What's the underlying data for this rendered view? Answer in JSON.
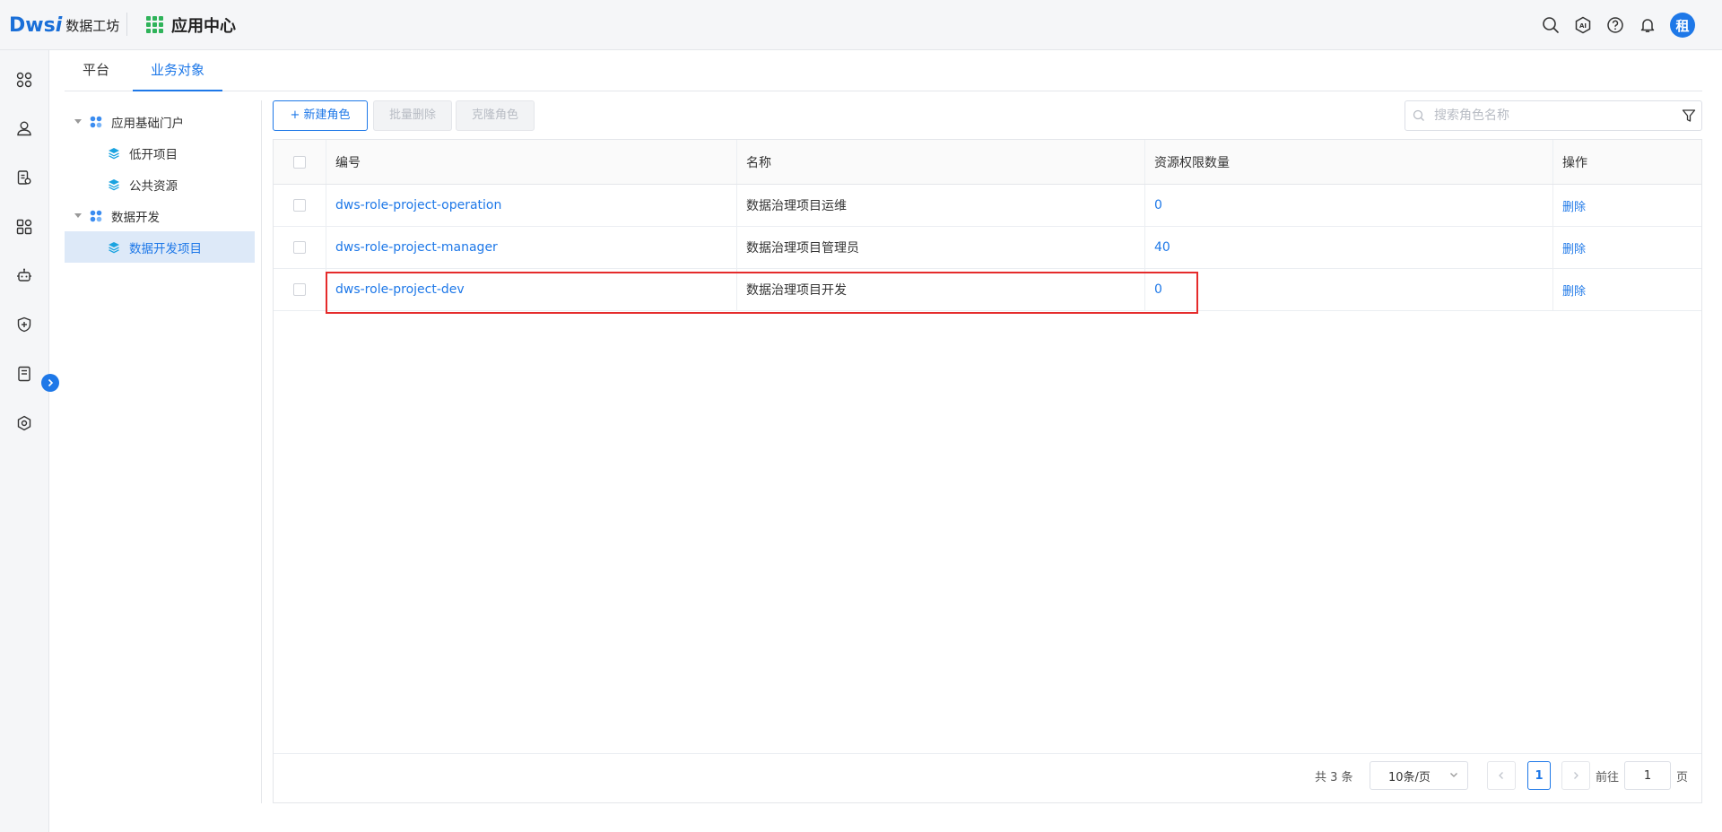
{
  "header": {
    "logo_mark": "Dws",
    "logo_mark_i": "i",
    "logo_text": "数据工坊",
    "app_center_label": "应用中心",
    "avatar_text": "租"
  },
  "tabs": [
    {
      "label": "平台",
      "active": false
    },
    {
      "label": "业务对象",
      "active": true
    }
  ],
  "tree": {
    "group1": {
      "label": "应用基础门户",
      "children": [
        "低开项目",
        "公共资源"
      ]
    },
    "group2": {
      "label": "数据开发",
      "children": [
        "数据开发项目"
      ]
    }
  },
  "toolbar": {
    "new_role": "新建角色",
    "new_role_plus": "+",
    "batch_delete": "批量删除",
    "clone_role": "克隆角色",
    "search_placeholder": "搜索角色名称"
  },
  "table": {
    "headers": {
      "code": "编号",
      "name": "名称",
      "perm_count": "资源权限数量",
      "action": "操作"
    },
    "rows": [
      {
        "code": "dws-role-project-operation",
        "name": "数据治理项目运维",
        "perm_count": "0",
        "action": "删除"
      },
      {
        "code": "dws-role-project-manager",
        "name": "数据治理项目管理员",
        "perm_count": "40",
        "action": "删除"
      },
      {
        "code": "dws-role-project-dev",
        "name": "数据治理项目开发",
        "perm_count": "0",
        "action": "删除"
      }
    ]
  },
  "pager": {
    "total": "共 3 条",
    "page_size": "10条/页",
    "current_page": "1",
    "goto_label": "前往",
    "goto_value": "1",
    "page_unit": "页"
  },
  "colors": {
    "accent": "#1e78e8",
    "highlight": "#e52b2b",
    "grid_icon": "#2fb35a"
  },
  "icons": {
    "rail": [
      "apps-icon",
      "user-icon",
      "document-icon",
      "modules-icon",
      "robot-icon",
      "shield-plus-icon",
      "clipboard-icon",
      "settings-hex-icon"
    ],
    "header": [
      "search-icon",
      "ai-icon",
      "help-icon",
      "bell-icon"
    ]
  }
}
